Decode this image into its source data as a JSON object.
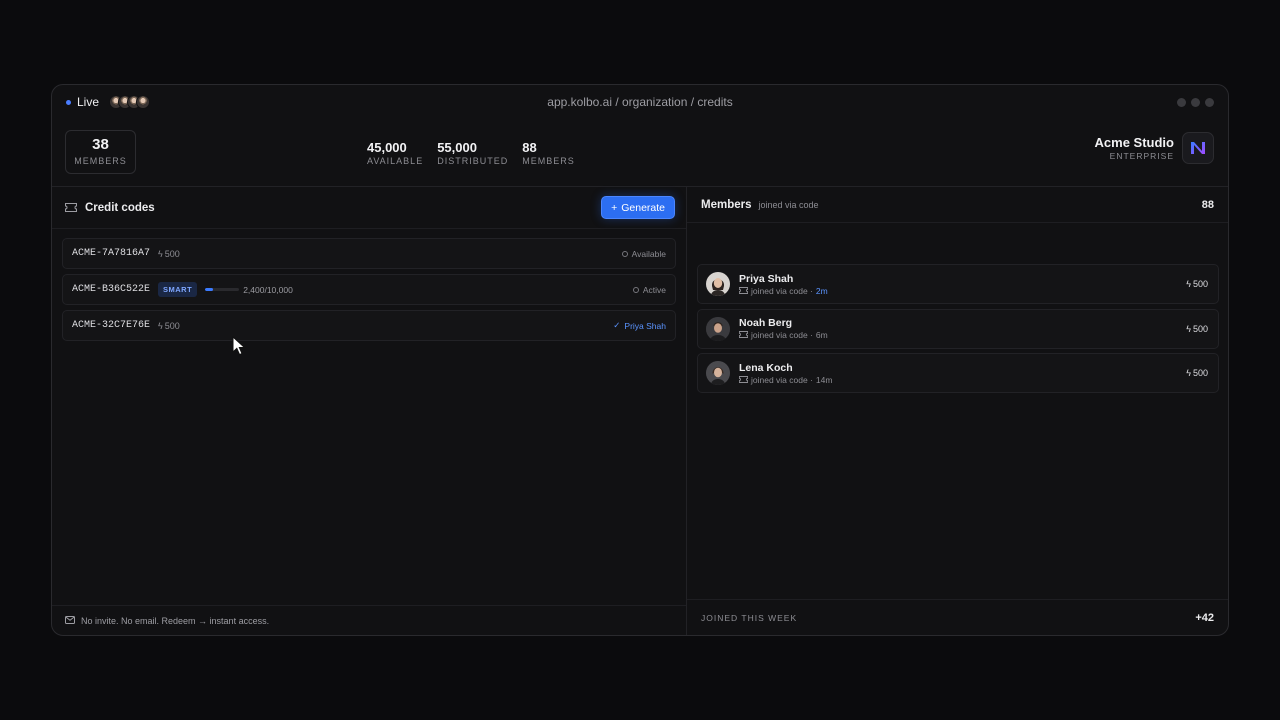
{
  "titlebar": {
    "live_label": "Live",
    "url": "app.kolbo.ai / organization / credits"
  },
  "stats": {
    "members_card": {
      "value": "38",
      "label": "MEMBERS"
    },
    "items": [
      {
        "value": "45,000",
        "label": "AVAILABLE"
      },
      {
        "value": "55,000",
        "label": "DISTRIBUTED"
      },
      {
        "value": "88",
        "label": "MEMBERS"
      }
    ]
  },
  "org": {
    "name": "Acme Studio",
    "tier": "ENTERPRISE"
  },
  "codes_panel": {
    "title": "Credit codes",
    "generate_label": "Generate",
    "codes": [
      {
        "code": "ACME-7A7816A7",
        "credits": "500",
        "status": "Available"
      },
      {
        "code": "ACME-B36C522E",
        "badge": "SMART",
        "progress_text": "2,400/10,000",
        "progress": 0.24,
        "status": "Active"
      },
      {
        "code": "ACME-32C7E76E",
        "credits": "500",
        "status": "Priya Shah"
      }
    ],
    "footer": "No invite. No email. Redeem → instant access."
  },
  "members_panel": {
    "title": "Members",
    "subtitle": "joined via code",
    "count": "88",
    "members": [
      {
        "name": "Priya Shah",
        "meta": "joined via code ·",
        "time": "2m",
        "credits": "500"
      },
      {
        "name": "Noah Berg",
        "meta": "joined via code ·",
        "time": "6m",
        "credits": "500"
      },
      {
        "name": "Lena Koch",
        "meta": "joined via code ·",
        "time": "14m",
        "credits": "500"
      }
    ],
    "footer_label": "JOINED THIS WEEK",
    "footer_value": "+42"
  },
  "colors": {
    "accent": "#2c6ef2",
    "accent_text": "#5b94ff",
    "background": "#111113"
  },
  "icons": [
    "live-dot-icon",
    "ticket-icon",
    "plus-icon",
    "bolt-icon",
    "check-icon",
    "mail-icon",
    "org-logo-icon",
    "cursor-icon"
  ]
}
